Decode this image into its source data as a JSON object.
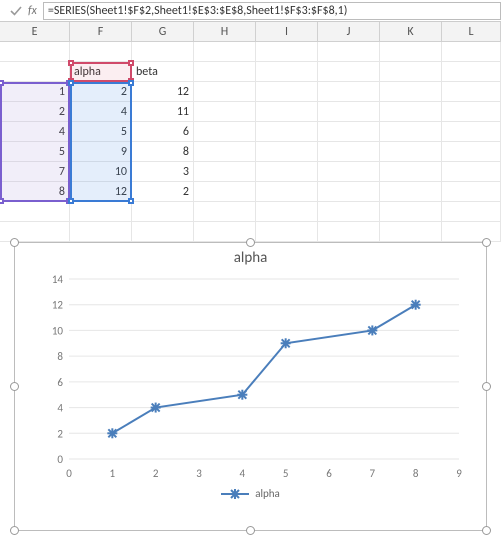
{
  "formula_bar": {
    "fx_label": "fx",
    "formula": "=SERIES(Sheet1!$F$2,Sheet1!$E$3:$E$8,Sheet1!$F$3:$F$8,1)"
  },
  "columns": [
    "E",
    "F",
    "G",
    "H",
    "I",
    "J",
    "K",
    "L"
  ],
  "headers": {
    "F2": "alpha",
    "G2": "beta"
  },
  "table": {
    "rows": [
      {
        "E": "1",
        "F": "2",
        "G": "12"
      },
      {
        "E": "2",
        "F": "4",
        "G": "11"
      },
      {
        "E": "4",
        "F": "5",
        "G": "6"
      },
      {
        "E": "5",
        "F": "9",
        "G": "8"
      },
      {
        "E": "7",
        "F": "10",
        "G": "3"
      },
      {
        "E": "8",
        "F": "12",
        "G": "2"
      }
    ]
  },
  "chart_data": {
    "type": "line",
    "title": "alpha",
    "xlabel": "",
    "ylabel": "",
    "xlim": [
      0,
      9
    ],
    "ylim": [
      0,
      14
    ],
    "xticks": [
      0,
      1,
      2,
      3,
      4,
      5,
      6,
      7,
      8,
      9
    ],
    "yticks": [
      0,
      2,
      4,
      6,
      8,
      10,
      12,
      14
    ],
    "series": [
      {
        "name": "alpha",
        "x": [
          1,
          2,
          4,
          5,
          7,
          8
        ],
        "y": [
          2,
          4,
          5,
          9,
          10,
          12
        ]
      }
    ],
    "legend_position": "bottom"
  },
  "legend": {
    "label": "alpha"
  }
}
